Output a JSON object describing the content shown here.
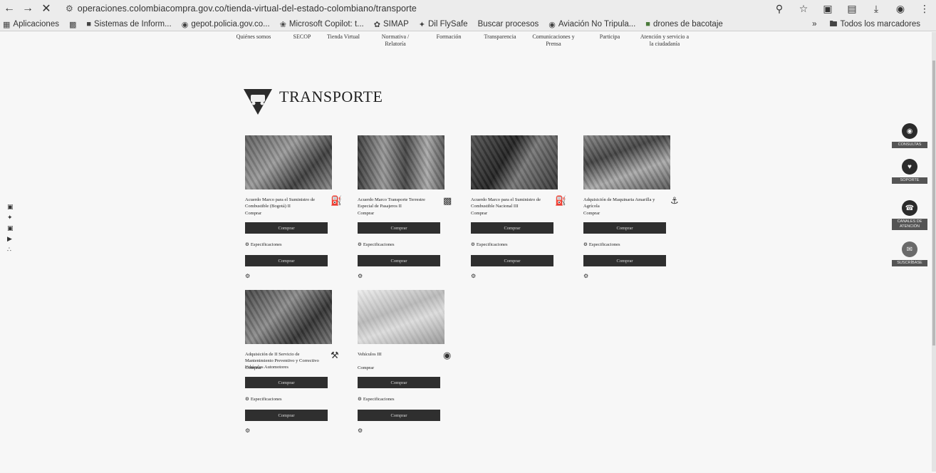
{
  "browser": {
    "url": "operaciones.colombiacompra.gov.co/tienda-virtual-del-estado-colombiano/transporte",
    "bookmarks": [
      {
        "label": "Aplicaciones",
        "icon": "apps-grid-icon"
      },
      {
        "label": "Sistemas de Inform...",
        "icon": "site-icon"
      },
      {
        "label": "gepot.policia.gov.co...",
        "icon": "globe-icon"
      },
      {
        "label": "Microsoft Copilot: t...",
        "icon": "copilot-icon"
      },
      {
        "label": "SIMAP",
        "icon": "simap-icon"
      },
      {
        "label": "Dil FlySafe",
        "icon": "eagle-icon"
      },
      {
        "label": "Buscar procesos",
        "icon": "none"
      },
      {
        "label": "Aviación No Tripula...",
        "icon": "drone-icon"
      },
      {
        "label": "drones de bacotaje",
        "icon": "folder-green-icon"
      }
    ],
    "all_bookmarks_label": "Todos los marcadores",
    "more_label": "»"
  },
  "site_nav": [
    {
      "label": "Quiénes somos"
    },
    {
      "label": "SECOP"
    },
    {
      "label": "Tienda Virtual"
    },
    {
      "label": "Normativa / Relatoría"
    },
    {
      "label": "Formación"
    },
    {
      "label": "Transparencia"
    },
    {
      "label": "Comunicaciones y Prensa"
    },
    {
      "label": "Participa"
    },
    {
      "label": "Atención y servicio a la ciudadanía"
    }
  ],
  "page": {
    "title": "TRANSPORTE"
  },
  "cards": [
    {
      "title": "Acuerdo Marco para el Suministro de Combustible (Bogotá) II",
      "sub": "Comprar",
      "buy": "Comprar",
      "spec": "Especificaciones",
      "buy2": "Comprar"
    },
    {
      "title": "Acuerdo Marco Transporte Terrestre Especial de Pasajeros II",
      "sub": "Comprar",
      "buy": "Comprar",
      "spec": "Especificaciones",
      "buy2": "Comprar"
    },
    {
      "title": "Acuerdo Marco para el Suministro de Combustible Nacional III",
      "sub": "Comprar",
      "buy": "Comprar",
      "spec": "Especificaciones",
      "buy2": "Comprar"
    },
    {
      "title": "Adquisición de Maquinaria Amarilla y Agrícola",
      "sub": "Comprar",
      "buy": "Comprar",
      "spec": "Especificaciones",
      "buy2": "Comprar"
    },
    {
      "title": "Adquisición de II Servicio de Mantenimiento Preventivo y Correctivo Vehículos Automotores",
      "sub": "Comprar",
      "buy": "Comprar",
      "spec": "Especificaciones",
      "buy2": "Comprar"
    },
    {
      "title": "Vehículos III",
      "sub": "Comprar",
      "buy": "Comprar",
      "spec": "Especificaciones",
      "buy2": "Comprar"
    }
  ],
  "right_widgets": [
    {
      "label": "CONSULTAS"
    },
    {
      "label": "SOPORTE"
    },
    {
      "label": "CANALES DE ATENCIÓN"
    },
    {
      "label": "SUSCRÍBASE"
    }
  ],
  "social": [
    "facebook-icon",
    "twitter-icon",
    "linkedin-icon",
    "youtube-icon",
    "rss-icon"
  ]
}
